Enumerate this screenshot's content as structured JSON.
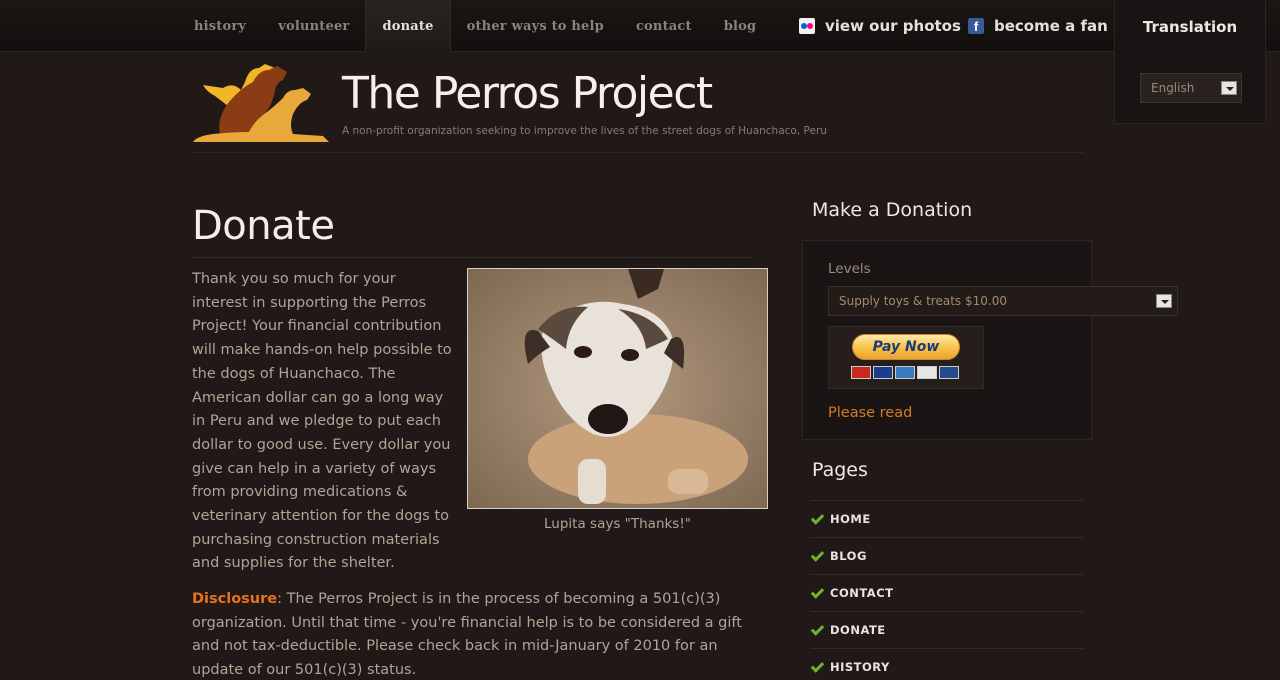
{
  "nav": {
    "items": [
      {
        "label": "history",
        "active": false
      },
      {
        "label": "volunteer",
        "active": false
      },
      {
        "label": "donate",
        "active": true
      },
      {
        "label": "other ways to help",
        "active": false
      },
      {
        "label": "contact",
        "active": false
      },
      {
        "label": "blog",
        "active": false
      }
    ]
  },
  "social": {
    "photos": {
      "label": "view our photos",
      "icon": "flickr-icon"
    },
    "fan": {
      "label": "become a fan",
      "icon": "facebook-icon"
    }
  },
  "translation": {
    "title": "Translation",
    "language": "English"
  },
  "header": {
    "title": "The Perros Project",
    "tagline": "A non-profit organization seeking to improve the lives of the street dogs of Huanchaco, Peru"
  },
  "main": {
    "title": "Donate",
    "intro": "Thank you so much for your interest in supporting the Perros Project! Your financial contribution will make hands-on help possible to the dogs of Huanchaco. The American dollar can go a long way in Peru and we pledge to put each dollar to good use. Every dollar you give can help in a variety of ways from providing medications & veterinary attention for the dogs to purchasing construction materials and supplies for the shelter.",
    "photo_caption": "Lupita says \"Thanks!\"",
    "disclosure_label": "Disclosure",
    "disclosure_text": ": The Perros Project is in the process of becoming a 501(c)(3) organization. Until that time - you're financial help is to be considered a gift and not tax-deductible. Please check back in mid-January of 2010 for an update of our 501(c)(3) status."
  },
  "sidebar": {
    "donation_heading": "Make a Donation",
    "levels_label": "Levels",
    "levels_selected": "Supply toys & treats $10.00",
    "pay_button": "Pay Now",
    "please_read": "Please read",
    "pages_heading": "Pages",
    "pages": [
      "HOME",
      "BLOG",
      "CONTACT",
      "DONATE",
      "HISTORY"
    ]
  },
  "colors": {
    "background": "#211917",
    "accent_orange": "#e8721c",
    "check_green": "#6fb22c"
  }
}
